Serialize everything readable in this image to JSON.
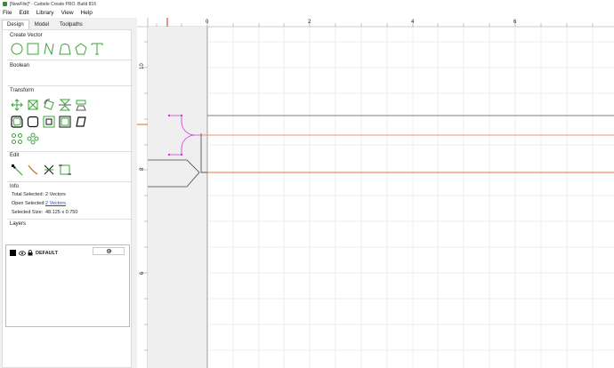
{
  "window": {
    "title": "[NewFile]* - Carbide Create PRO. Build 816"
  },
  "menu": [
    "File",
    "Edit",
    "Library",
    "View",
    "Help"
  ],
  "tabs": [
    "Design",
    "Model",
    "Toolpaths"
  ],
  "sections": {
    "create_vector": "Create Vector",
    "boolean": "Boolean",
    "transform": "Transform",
    "edit": "Edit",
    "info": "Info",
    "layers": "Layers"
  },
  "info": {
    "total_selected_label": "Total Selected:",
    "total_selected_value": "2 Vectors",
    "open_selected_label": "Open Selected:",
    "open_selected_value": "2 Vectors",
    "selected_size_label": "Selected Size:",
    "selected_size_value": "48.125 x 0.750"
  },
  "layers": [
    {
      "name": "DEFAULT",
      "color": "#000000"
    }
  ],
  "ruler": {
    "x_ticks": [
      "0",
      "2",
      "4",
      "6"
    ],
    "y_ticks": [
      "10",
      "8",
      "6"
    ]
  },
  "colors": {
    "accent_green": "#3aa53a",
    "guide_orange": "#e8743b",
    "selection_magenta": "#d23ad2"
  }
}
